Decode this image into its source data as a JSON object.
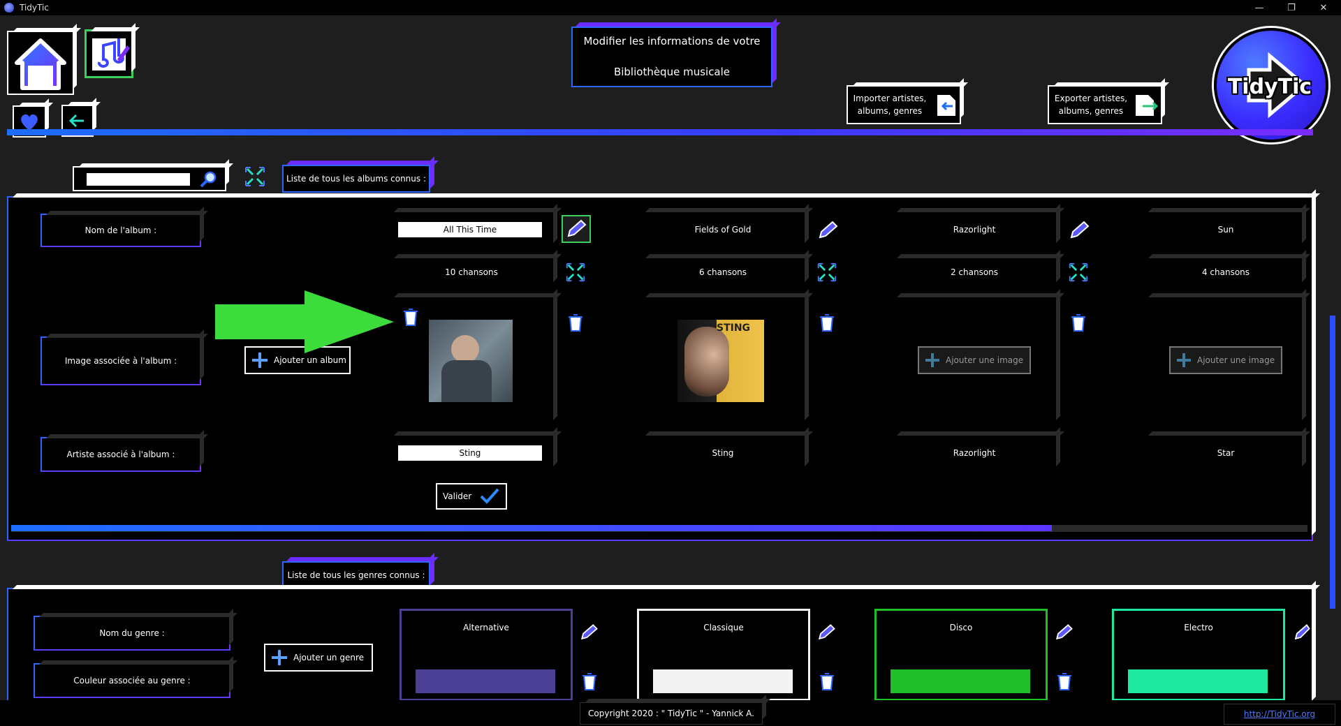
{
  "window": {
    "title": "TidyTic",
    "minimize": "—",
    "restore": "❐",
    "close": "✕"
  },
  "header": {
    "title_line1": "Modifier les informations de votre",
    "title_line2": "Bibliothèque musicale",
    "import_label_1": "Importer artistes,",
    "import_label_2": "albums, genres",
    "export_label_1": "Exporter artistes,",
    "export_label_2": "albums, genres",
    "logo_text": "TidyTic"
  },
  "albums_section": {
    "tab_label": "Liste de tous les albums connus :",
    "search_value": "",
    "row_labels": {
      "name": "Nom de l'album :",
      "image": "Image associée à l'album :",
      "artist": "Artiste associé à l'album :"
    },
    "add_album_label": "Ajouter un album",
    "validate_label": "Valider",
    "add_image_label": "Ajouter une image",
    "albums": [
      {
        "name": "All This Time",
        "songs": "10 chansons",
        "artist": "Sting"
      },
      {
        "name": "Fields of Gold",
        "songs": "6 chansons",
        "artist": "Sting"
      },
      {
        "name": "Razorlight",
        "songs": "2 chansons",
        "artist": "Razorlight"
      },
      {
        "name": "Sun",
        "songs": "4 chansons",
        "artist": "Star"
      }
    ],
    "cover_text": "STING"
  },
  "genres_section": {
    "tab_label": "Liste de tous les genres connus :",
    "row_labels": {
      "name": "Nom du genre :",
      "color": "Couleur associée au genre :"
    },
    "add_genre_label": "Ajouter un genre",
    "genres": [
      {
        "name": "Alternative",
        "color": "#4b3f96"
      },
      {
        "name": "Classique",
        "color": "#f2f2f2"
      },
      {
        "name": "Disco",
        "color": "#1fbf2a"
      },
      {
        "name": "Electro",
        "color": "#1ee8a0"
      }
    ]
  },
  "footer": {
    "copyright": "Copyright 2020 : \" TidyTic \" - Yannick A.",
    "link": "http://TidyTic.org"
  },
  "colors": {
    "accent_blue": "#2c67ff",
    "accent_violet": "#6b2cff",
    "arrow_green": "#3ddc3d"
  }
}
